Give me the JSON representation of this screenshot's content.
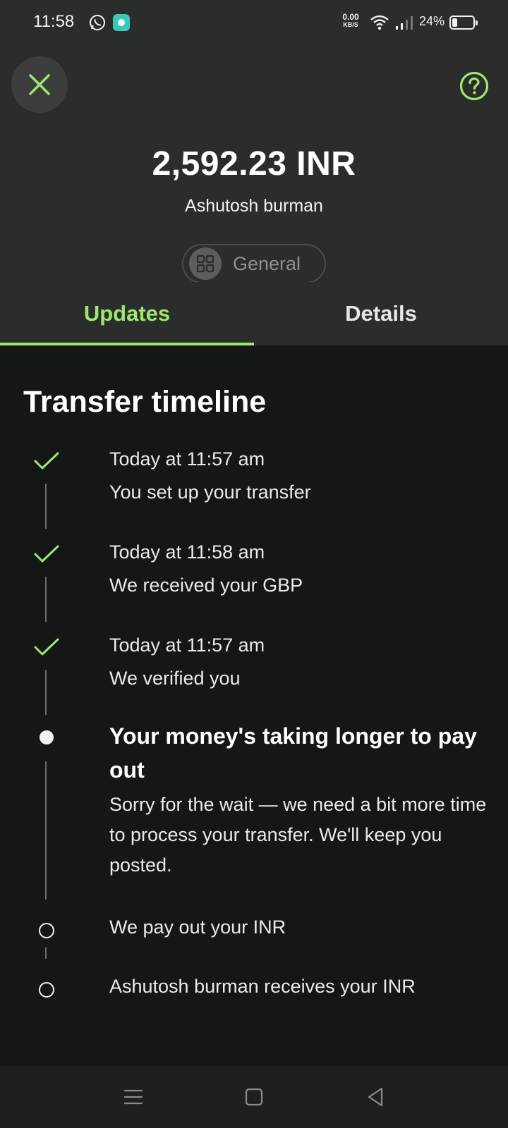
{
  "status_bar": {
    "time": "11:58",
    "net_speed_value": "0.00",
    "net_speed_unit": "KB/S",
    "battery_percent": "24%"
  },
  "header": {
    "amount": "2,592.23 INR",
    "recipient": "Ashutosh burman",
    "category": "General"
  },
  "tabs": [
    {
      "label": "Updates",
      "active": true
    },
    {
      "label": "Details",
      "active": false
    }
  ],
  "timeline": {
    "title": "Transfer timeline",
    "steps": [
      {
        "status": "done",
        "time": "Today at 11:57 am",
        "text": "You set up your transfer"
      },
      {
        "status": "done",
        "time": "Today at 11:58 am",
        "text": "We received your GBP"
      },
      {
        "status": "done",
        "time": "Today at 11:57 am",
        "text": "We verified you"
      },
      {
        "status": "current",
        "title": "Your money's taking longer to pay out",
        "text": "Sorry for the wait — we need a bit more time to process your transfer. We'll keep you posted."
      },
      {
        "status": "pending",
        "text": "We pay out your INR"
      },
      {
        "status": "pending",
        "text": "Ashutosh burman receives your INR"
      }
    ]
  },
  "colors": {
    "accent": "#9fe870",
    "header_bg": "#2b2d2c",
    "body_bg": "#151716"
  },
  "icons": {
    "close": "close-icon",
    "help": "help-icon",
    "category": "grid-icon",
    "done": "check-icon"
  }
}
